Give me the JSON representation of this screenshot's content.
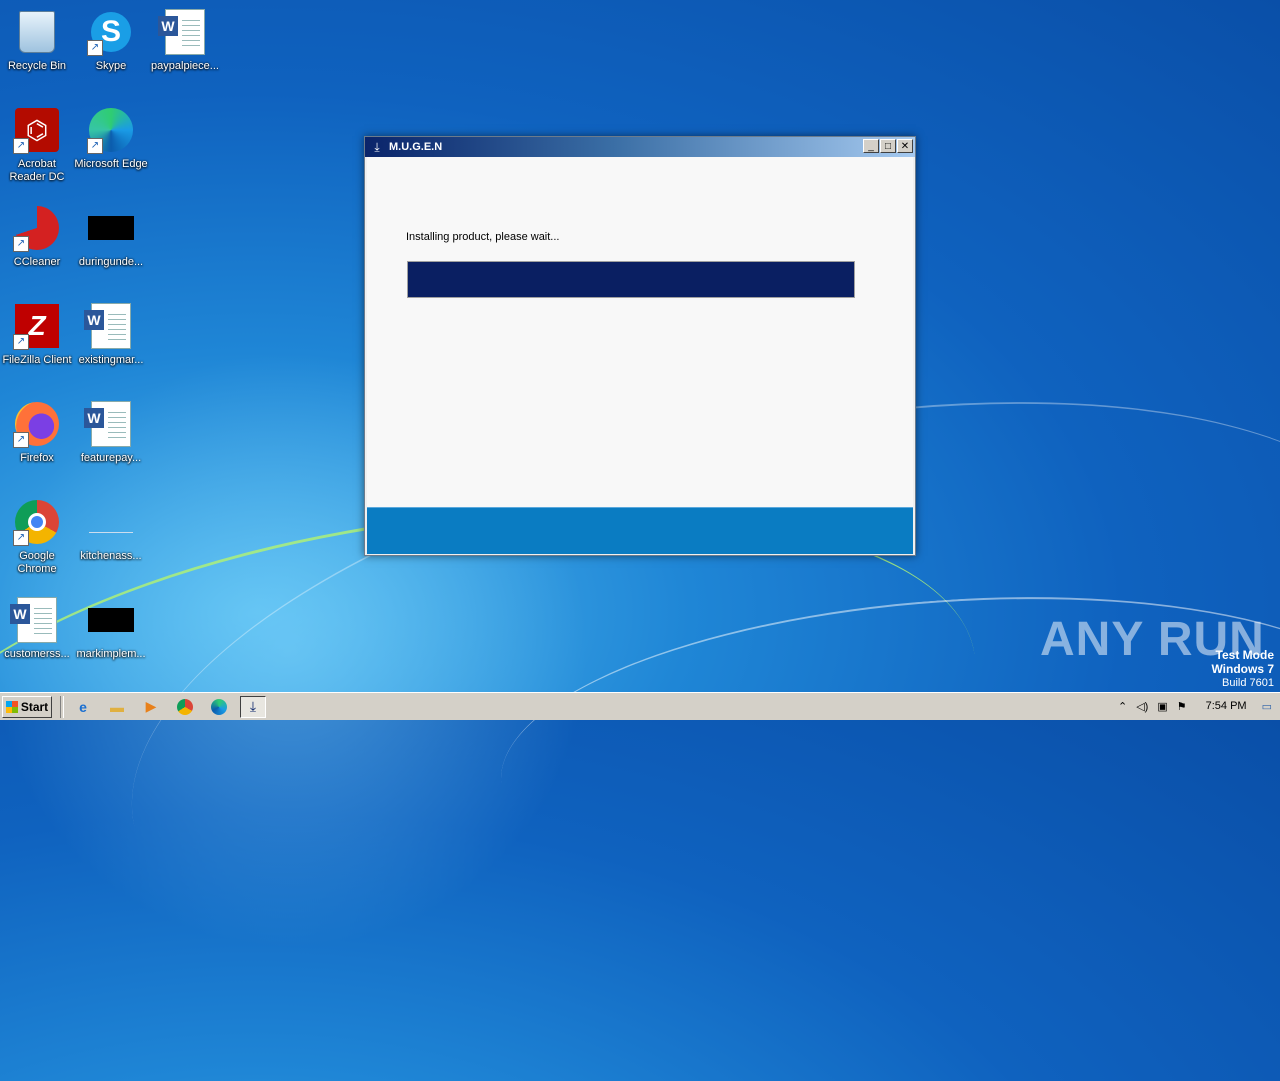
{
  "desktop": {
    "icons": [
      {
        "label": "Recycle Bin",
        "icon": "recycle-bin-icon"
      },
      {
        "label": "Skype",
        "icon": "skype-icon"
      },
      {
        "label": "paypalpiece...",
        "icon": "word-document-icon"
      },
      {
        "label": "Acrobat Reader DC",
        "icon": "acrobat-reader-icon"
      },
      {
        "label": "Microsoft Edge",
        "icon": "edge-icon"
      },
      {
        "label": "CCleaner",
        "icon": "ccleaner-icon"
      },
      {
        "label": "duringunde...",
        "icon": "black-file-icon"
      },
      {
        "label": "FileZilla Client",
        "icon": "filezilla-icon"
      },
      {
        "label": "existingmar...",
        "icon": "word-document-icon"
      },
      {
        "label": "Firefox",
        "icon": "firefox-icon"
      },
      {
        "label": "featurepay...",
        "icon": "word-document-icon"
      },
      {
        "label": "Google Chrome",
        "icon": "chrome-icon"
      },
      {
        "label": "kitchenass...",
        "icon": "blank-file-icon"
      },
      {
        "label": "customerss...",
        "icon": "word-document-icon"
      },
      {
        "label": "markimplem...",
        "icon": "black-file-icon"
      }
    ]
  },
  "installer": {
    "title": "M.U.G.E.N",
    "status": "Installing product, please wait...",
    "progress": 1.0,
    "buttons": {
      "minimize": "_",
      "maximize": "□",
      "close": "✕"
    }
  },
  "taskbar": {
    "start_label": "Start",
    "pinned": [
      "internet-explorer-icon",
      "folder-icon",
      "media-player-icon",
      "chrome-icon",
      "edge-icon",
      "installer-icon"
    ],
    "clock": "7:54 PM"
  },
  "watermark": {
    "brand": "ANY RUN",
    "test_mode": "Test Mode",
    "os": "Windows 7",
    "build": "Build 7601"
  },
  "colors": {
    "progress_fill": "#0a1f62",
    "footer": "#0a7cc2",
    "desktop": "#1f86d6"
  }
}
